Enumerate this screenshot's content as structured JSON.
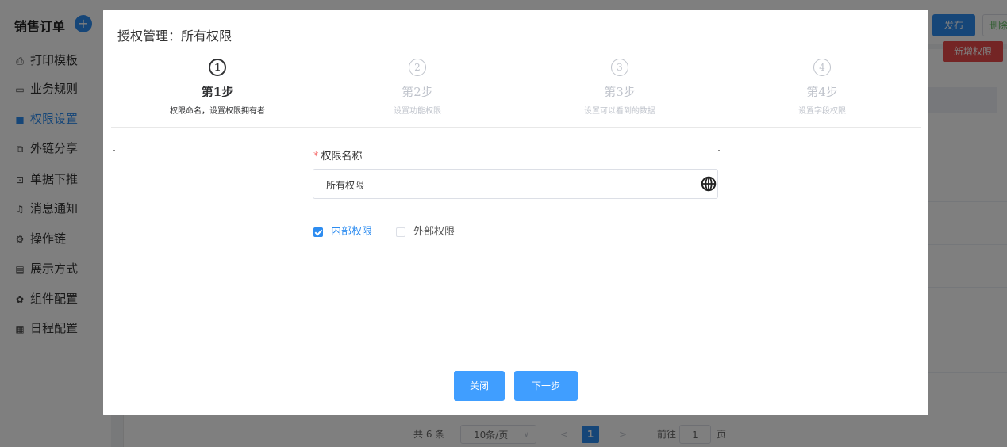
{
  "app": {
    "title": "销售订单",
    "add_icon": "+",
    "publish_label": "发布",
    "delete_label": "删除"
  },
  "sidebar": {
    "items": [
      {
        "label": "打印模板",
        "icon": "printer-icon",
        "glyph": "⎙"
      },
      {
        "label": "业务规则",
        "icon": "rule-icon",
        "glyph": "▭"
      },
      {
        "label": "权限设置",
        "icon": "permission-icon",
        "glyph": "■",
        "active": true
      },
      {
        "label": "外链分享",
        "icon": "share-icon",
        "glyph": "⧉"
      },
      {
        "label": "单据下推",
        "icon": "push-icon",
        "glyph": "⊡"
      },
      {
        "label": "消息通知",
        "icon": "bell-icon",
        "glyph": "♫"
      },
      {
        "label": "操作链",
        "icon": "gear-icon",
        "glyph": "⚙"
      },
      {
        "label": "展示方式",
        "icon": "display-icon",
        "glyph": "▤"
      },
      {
        "label": "组件配置",
        "icon": "component-icon",
        "glyph": "✿"
      },
      {
        "label": "日程配置",
        "icon": "calendar-icon",
        "glyph": "▦"
      }
    ]
  },
  "background": {
    "new_permission_label": "新增权限"
  },
  "pagination": {
    "total": "共 6 条",
    "page_size": "10条/页",
    "prev": "<",
    "current": "1",
    "next": ">",
    "goto_label": "前往",
    "goto_value": "1",
    "unit": "页"
  },
  "modal": {
    "title": "授权管理：所有权限",
    "steps": [
      {
        "num": "1",
        "title": "第1步",
        "desc": "权限命名，设置权限拥有者",
        "active": true
      },
      {
        "num": "2",
        "title": "第2步",
        "desc": "设置功能权限",
        "active": false
      },
      {
        "num": "3",
        "title": "第3步",
        "desc": "设置可以看到的数据",
        "active": false
      },
      {
        "num": "4",
        "title": "第4步",
        "desc": "设置字段权限",
        "active": false
      }
    ],
    "form": {
      "required_mark": "*",
      "name_label": "权限名称",
      "name_value": "所有权限",
      "globe_icon": "globe-icon",
      "internal_label": "内部权限",
      "internal_checked": true,
      "external_label": "外部权限",
      "external_checked": false
    },
    "close_label": "关闭",
    "next_label": "下一步"
  },
  "colors": {
    "primary": "#409eff",
    "accent_blue": "#2d8cf0",
    "danger": "#e84b4b"
  }
}
